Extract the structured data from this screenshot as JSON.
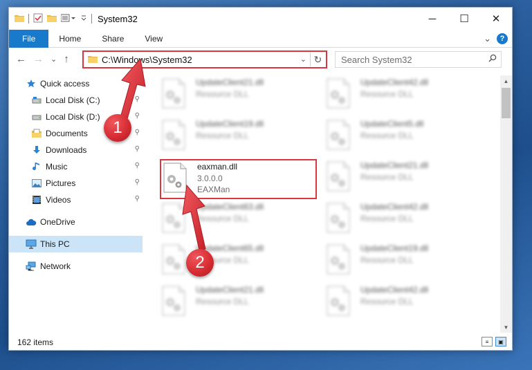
{
  "window": {
    "title": "System32",
    "minimize_label": "─",
    "maximize_label": "☐",
    "close_label": "✕"
  },
  "ribbon": {
    "tabs": [
      {
        "label": "File"
      },
      {
        "label": "Home"
      },
      {
        "label": "Share"
      },
      {
        "label": "View"
      }
    ],
    "help_label": "?",
    "expand_label": "⌄"
  },
  "nav": {
    "back_label": "←",
    "forward_label": "→",
    "recent_label": "⌄",
    "up_label": "↑"
  },
  "address": {
    "path": "C:\\Windows\\System32",
    "refresh_label": "↻"
  },
  "search": {
    "placeholder": "Search System32"
  },
  "sidebar": {
    "items": [
      {
        "label": "Quick access",
        "icon": "star-icon",
        "pinned": false
      },
      {
        "label": "Local Disk (C:)",
        "icon": "drive-icon",
        "pinned": true
      },
      {
        "label": "Local Disk (D:)",
        "icon": "drive-icon",
        "pinned": true
      },
      {
        "label": "Documents",
        "icon": "documents-icon",
        "pinned": true
      },
      {
        "label": "Downloads",
        "icon": "download-icon",
        "pinned": true
      },
      {
        "label": "Music",
        "icon": "music-icon",
        "pinned": true
      },
      {
        "label": "Pictures",
        "icon": "pictures-icon",
        "pinned": true
      },
      {
        "label": "Videos",
        "icon": "videos-icon",
        "pinned": true
      },
      {
        "label": "OneDrive",
        "icon": "cloud-icon",
        "pinned": false
      },
      {
        "label": "This PC",
        "icon": "monitor-icon",
        "pinned": false
      },
      {
        "label": "Network",
        "icon": "network-icon",
        "pinned": false
      }
    ],
    "pin_glyph": "📌"
  },
  "files": [
    {
      "name": "UpdateClient21.dll",
      "line2": "Resource DLL",
      "line3": ""
    },
    {
      "name": "UpdateClient42.dll",
      "line2": "Resource DLL",
      "line3": ""
    },
    {
      "name": "UpdateClient19.dll",
      "line2": "Resource DLL",
      "line3": ""
    },
    {
      "name": "UpdateClient5.dll",
      "line2": "Resource DLL",
      "line3": ""
    },
    {
      "name": "eaxman.dll",
      "line2": "3.0.0.0",
      "line3": "EAXMan"
    },
    {
      "name": "UpdateClient21.dll",
      "line2": "Resource DLL",
      "line3": ""
    },
    {
      "name": "UpdateClient63.dll",
      "line2": "Resource DLL",
      "line3": ""
    },
    {
      "name": "UpdateClient42.dll",
      "line2": "Resource DLL",
      "line3": ""
    },
    {
      "name": "UpdateClient65.dll",
      "line2": "Resource DLL",
      "line3": ""
    },
    {
      "name": "UpdateClient19.dll",
      "line2": "Resource DLL",
      "line3": ""
    },
    {
      "name": "UpdateClient21.dll",
      "line2": "Resource DLL",
      "line3": ""
    },
    {
      "name": "UpdateClient42.dll",
      "line2": "Resource DLL",
      "line3": ""
    }
  ],
  "callouts": [
    {
      "label": "1"
    },
    {
      "label": "2"
    }
  ],
  "status": {
    "item_count": "162 items"
  },
  "colors": {
    "accent": "#1979ca",
    "highlight_red": "#d9363e",
    "selection": "#cce4f7"
  }
}
